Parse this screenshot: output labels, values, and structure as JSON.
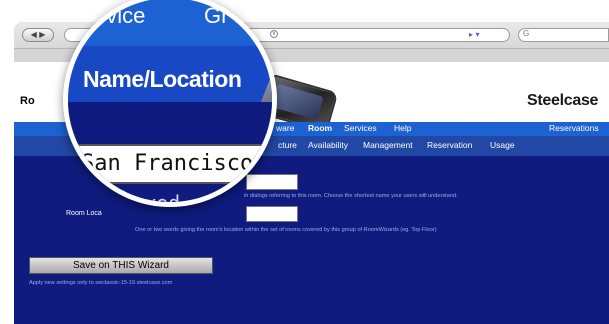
{
  "browser": {
    "nav_buttons": "◀ ▶",
    "url_buttons": "▸ ▾",
    "search_text": "G",
    "tab_close": "x"
  },
  "header": {
    "title": "Ro",
    "logo_text": "Steelcase"
  },
  "nav_main": {
    "items": [
      "ware",
      "Room",
      "Services",
      "Help"
    ],
    "current": "Room",
    "right_item": "Reservations"
  },
  "nav_sub": {
    "items": [
      "cture",
      "Availability",
      "Management",
      "Reservation",
      "Usage"
    ]
  },
  "form": {
    "name_help": "in dialogs referring to this room.  Choose the shortest  name your users will understand.",
    "location_label": "Room Loca",
    "location_help": "One or two words giving the room's location within the set of rooms covered by this group of RoomWizards (eg. Top Floor)",
    "save_button": "Save on THIS Wizard",
    "save_note": "Apply new settings only to swclassic-15-19.steelcase.com"
  },
  "magnifier": {
    "menu_left": "evice",
    "menu_right": "Gr",
    "label": "Name/Location",
    "name_value": "San Francisco",
    "location_partial": "layed on"
  },
  "colors": {
    "nav_primary": "#1d62d2",
    "nav_secondary": "#2248a5",
    "page_background": "#0f1b7e"
  }
}
